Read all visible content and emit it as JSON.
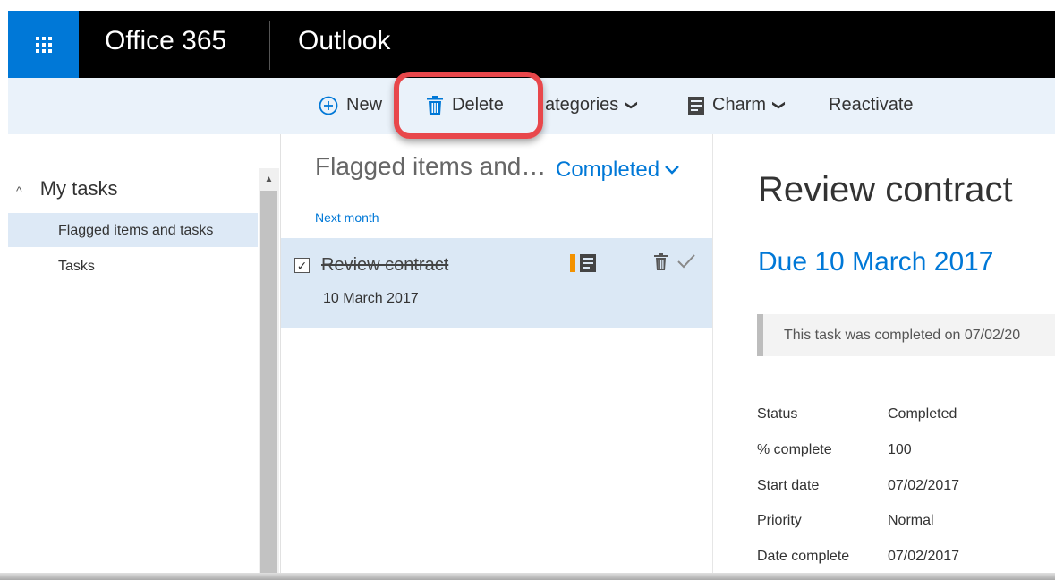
{
  "header": {
    "suite_title": "Office 365",
    "app_title": "Outlook",
    "accent_color": "#0078d7"
  },
  "toolbar": {
    "new_label": "New",
    "delete_label": "Delete",
    "categories_label": "ategories",
    "charm_label": "Charm",
    "reactivate_label": "Reactivate",
    "highlight_color": "#e8474b"
  },
  "sidebar": {
    "group_label": "My tasks",
    "items": [
      {
        "label": "Flagged items and tasks",
        "selected": true
      },
      {
        "label": "Tasks",
        "selected": false
      }
    ]
  },
  "list": {
    "title": "Flagged items and…",
    "filter_label": "Completed",
    "group_header": "Next month",
    "tasks": [
      {
        "title": "Review contract",
        "date": "10 March 2017",
        "completed": true
      }
    ]
  },
  "reading": {
    "title": "Review contract",
    "due": "Due 10 March 2017",
    "notice": "This task was completed on 07/02/20",
    "details": [
      {
        "label": "Status",
        "value": "Completed"
      },
      {
        "label": "% complete",
        "value": "100"
      },
      {
        "label": "Start date",
        "value": "07/02/2017"
      },
      {
        "label": "Priority",
        "value": "Normal"
      },
      {
        "label": "Date complete",
        "value": "07/02/2017"
      }
    ]
  }
}
